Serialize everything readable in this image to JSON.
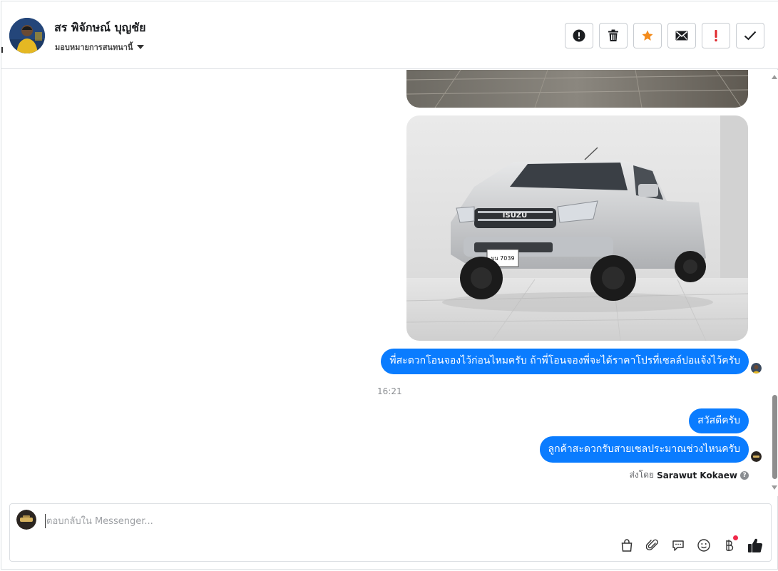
{
  "header": {
    "contact_name": "สร พิจักษณ์ บุญชัย",
    "assign_label": "มอบหมายการสนทนานี้"
  },
  "toolbar": {
    "buttons": [
      {
        "name": "report-spam",
        "icon": "exclamation-circle-icon"
      },
      {
        "name": "delete",
        "icon": "trash-icon"
      },
      {
        "name": "star",
        "icon": "star-icon"
      },
      {
        "name": "mark-unread",
        "icon": "envelope-icon"
      },
      {
        "name": "important",
        "icon": "exclamation-icon"
      },
      {
        "name": "mark-done",
        "icon": "check-icon"
      }
    ],
    "colors": {
      "star": "#f38b1c",
      "important": "#e0292e"
    }
  },
  "conversation": {
    "messages": [
      {
        "text": "พี่สะดวกโอนจองไว้ก่อนไหมครับ ถ้าพี่โอนจองพี่จะได้ราคาโปรที่เซลล์ปอแจ้งไว้ครับ"
      },
      {
        "text": "สวัสดีครับ"
      },
      {
        "text": "ลูกค้าสะดวกรับสายเซลประมาณช่วงไหนครับ"
      }
    ],
    "timestamp": "16:21",
    "sent_by_label": "ส่งโดย",
    "sent_by_name": "Sarawut Kokaew",
    "car_plate": "บบ 7039",
    "car_brand": "ISUZU",
    "bubble_color": "#0a7cff"
  },
  "composer": {
    "placeholder": "ตอบกลับใน Messenger..."
  }
}
